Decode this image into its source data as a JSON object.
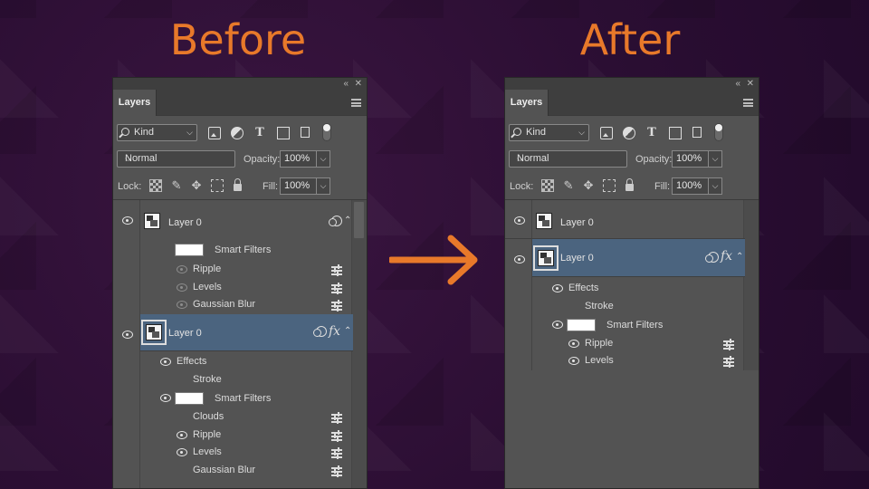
{
  "before_title": "Before",
  "after_title": "After",
  "panel": {
    "tab": "Layers",
    "collapse_glyph": "«",
    "close_glyph": "✕",
    "kind": "Kind",
    "blend_mode": "Normal",
    "opacity_label": "Opacity:",
    "opacity_value": "100%",
    "lock_label": "Lock:",
    "fill_label": "Fill:",
    "fill_value": "100%",
    "filter_type_icons": [
      "image-icon",
      "adjustment-icon",
      "type-icon",
      "shape-icon",
      "smart-object-icon"
    ],
    "lock_icons": [
      "lock-transparent-icon",
      "lock-paint-icon",
      "lock-position-icon",
      "lock-artboard-icon",
      "lock-all-icon"
    ]
  },
  "before": {
    "layer1": {
      "name": "Layer 0",
      "smart_filters": "Smart Filters",
      "filters": [
        "Ripple",
        "Levels",
        "Gaussian Blur"
      ]
    },
    "layer2": {
      "name": "Layer 0",
      "fx": "fx",
      "effects": "Effects",
      "stroke": "Stroke",
      "smart_filters": "Smart Filters",
      "filters": [
        "Clouds",
        "Ripple",
        "Levels",
        "Gaussian Blur"
      ]
    }
  },
  "after": {
    "layer1": {
      "name": "Layer 0"
    },
    "layer2": {
      "name": "Layer 0",
      "fx": "fx",
      "effects": "Effects",
      "stroke": "Stroke",
      "smart_filters": "Smart Filters",
      "filters": [
        "Ripple",
        "Levels"
      ]
    }
  },
  "colors": {
    "accent": "#e8792a",
    "selected": "#4b647f",
    "panel": "#535353"
  }
}
